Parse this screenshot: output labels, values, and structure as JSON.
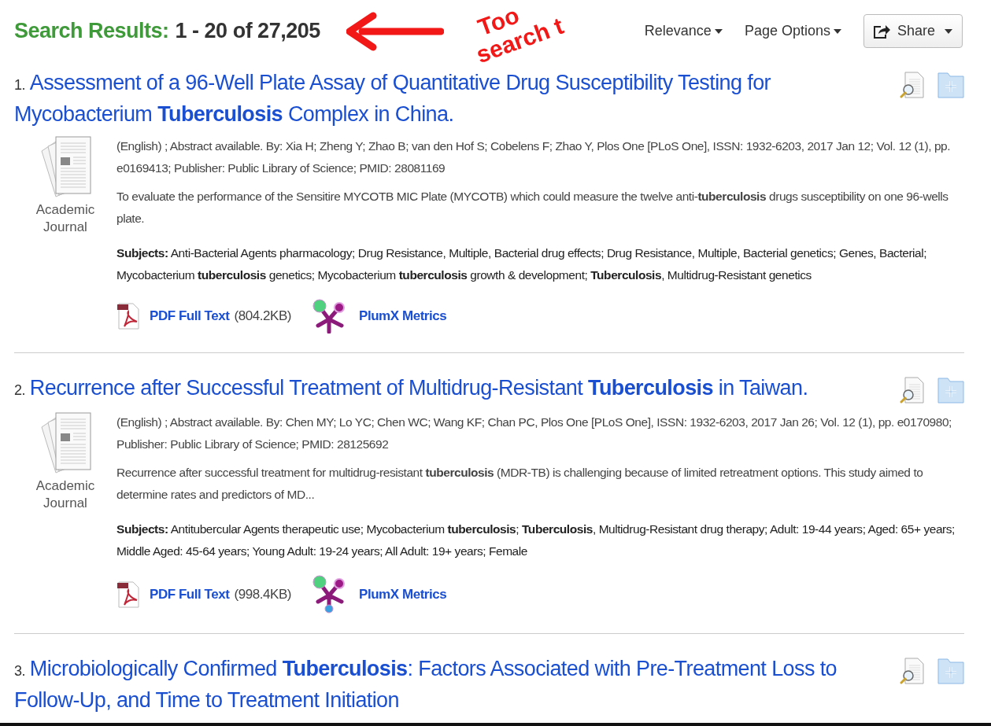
{
  "header": {
    "label": "Search Results:",
    "range": "1 - 20 of 27,205"
  },
  "menus": [
    {
      "label": "Relevance"
    },
    {
      "label": "Page Options"
    }
  ],
  "share": {
    "label": "Share"
  },
  "annotation": {
    "lines": [
      "Too",
      "search t"
    ]
  },
  "results": [
    {
      "number": "1.",
      "title": "Assessment of a 96-Well Plate Assay of Quantitative Drug Susceptibility Testing for Mycobacterium **Tuberculosis** Complex in China.",
      "type_label": "Academic Journal",
      "citation": "(English) ; Abstract available. By: Xia H; Zheng Y; Zhao B; van den Hof S; Cobelens F; Zhao Y, Plos One [PLoS One], ISSN: 1932-6203, 2017 Jan 12; Vol. 12 (1), pp. e0169413; Publisher: Public Library of Science; PMID: 28081169",
      "abstract": "To evaluate the performance of the Sensitire MYCOTB MIC Plate (MYCOTB) which could measure the twelve anti-**tuberculosis** drugs susceptibility on one 96-wells plate.",
      "subjects": "**Subjects:** Anti-Bacterial Agents pharmacology; Drug Resistance, Multiple, Bacterial drug effects; Drug Resistance, Multiple, Bacterial genetics; Genes, Bacterial; Mycobacterium **tuberculosis** genetics; Mycobacterium **tuberculosis** growth & development; **Tuberculosis**, Multidrug-Resistant genetics",
      "pdf_label": "PDF Full Text",
      "pdf_size": "(804.2KB)",
      "plumx_label": "PlumX Metrics",
      "plumx_third_dot": false
    },
    {
      "number": "2.",
      "title": "Recurrence after Successful Treatment of Multidrug-Resistant **Tuberculosis** in Taiwan.",
      "type_label": "Academic Journal",
      "citation": "(English) ; Abstract available. By: Chen MY; Lo YC; Chen WC; Wang KF; Chan PC, Plos One [PLoS One], ISSN: 1932-6203, 2017 Jan 26; Vol. 12 (1), pp. e0170980; Publisher: Public Library of Science; PMID: 28125692",
      "abstract": "Recurrence after successful treatment for multidrug-resistant **tuberculosis** (MDR-TB) is challenging because of limited retreatment options. This study aimed to determine rates and predictors of MD...",
      "subjects": "**Subjects:** Antitubercular Agents therapeutic use; Mycobacterium **tuberculosis**; **Tuberculosis**, Multidrug-Resistant drug therapy; Adult: 19-44 years; Aged: 65+ years; Middle Aged: 45-64 years; Young Adult: 19-24 years; All Adult: 19+ years; Female",
      "pdf_label": "PDF Full Text",
      "pdf_size": "(998.4KB)",
      "plumx_label": "PlumX Metrics",
      "plumx_third_dot": true
    },
    {
      "number": "3.",
      "title": "Microbiologically Confirmed **Tuberculosis**: Factors Associated with Pre-Treatment Loss to Follow-Up, and Time to Treatment Initiation"
    }
  ]
}
